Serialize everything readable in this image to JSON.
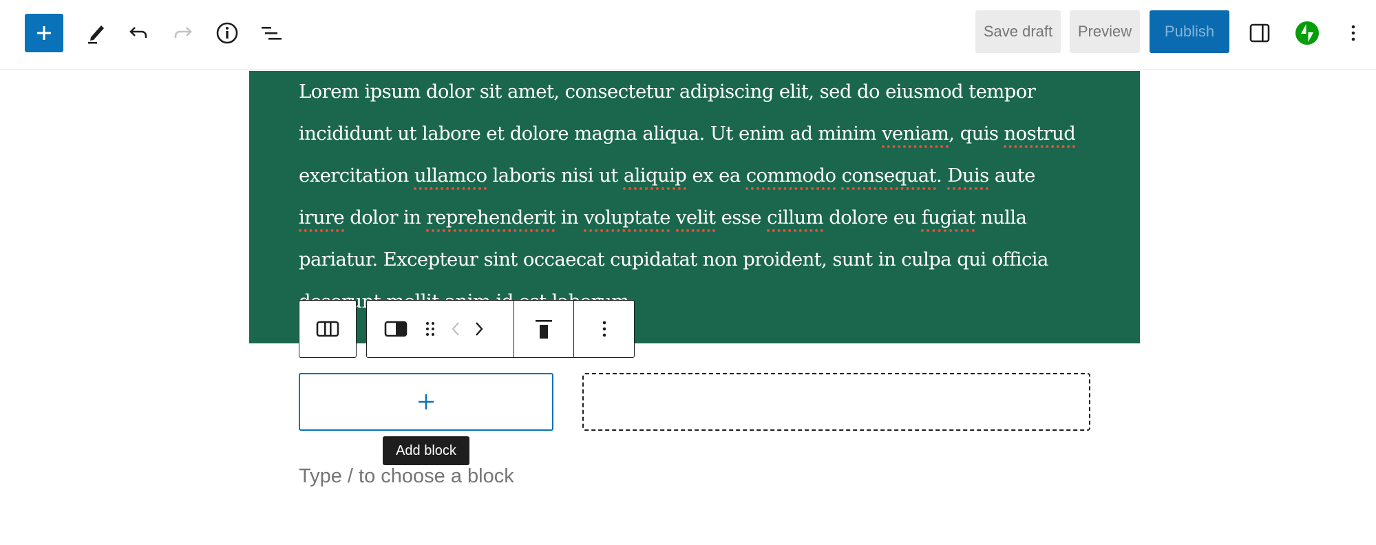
{
  "topbar": {
    "left_tools": [
      {
        "icon": "plus-icon",
        "label": "Toggle block inserter"
      },
      {
        "icon": "pencil-icon",
        "label": "Tools"
      },
      {
        "icon": "undo-icon",
        "label": "Undo"
      },
      {
        "icon": "redo-icon",
        "label": "Redo",
        "disabled": true
      },
      {
        "icon": "info-icon",
        "label": "Details"
      },
      {
        "icon": "list-view-icon",
        "label": "Document Overview"
      }
    ],
    "save_draft_label": "Save draft",
    "preview_label": "Preview",
    "publish_label": "Publish",
    "right_tools": [
      {
        "icon": "sidebar-toggle-icon",
        "label": "Settings"
      },
      {
        "icon": "jetpack-icon",
        "label": "Jetpack"
      },
      {
        "icon": "more-vertical-icon",
        "label": "Options"
      }
    ]
  },
  "colors": {
    "accent": "#0a72b9",
    "publish": "#0a6bb0",
    "cover_bg": "#1b674d",
    "spellcheck": "#e0503a",
    "jetpack": "#069e08"
  },
  "cover": {
    "lines": [
      [
        {
          "t": "Lorem ipsum dolor sit amet, consectetur adipiscing elit, sed do eiusmod tempor"
        }
      ],
      [
        {
          "t": "incididunt ut labore et dolore magna aliqua. Ut enim ad minim "
        },
        {
          "t": "veniam",
          "sp": true
        },
        {
          "t": ", quis "
        },
        {
          "t": "nostrud",
          "sp": true
        }
      ],
      [
        {
          "t": "exercitation "
        },
        {
          "t": "ullamco",
          "sp": true
        },
        {
          "t": " laboris nisi ut "
        },
        {
          "t": "aliquip",
          "sp": true
        },
        {
          "t": " ex ea "
        },
        {
          "t": "commodo",
          "sp": true
        },
        {
          "t": " "
        },
        {
          "t": "consequat",
          "sp": true
        },
        {
          "t": ". "
        },
        {
          "t": "Duis",
          "sp": true
        },
        {
          "t": " aute"
        }
      ],
      [
        {
          "t": "irure",
          "sp": true
        },
        {
          "t": " dolor in "
        },
        {
          "t": "reprehenderit",
          "sp": true
        },
        {
          "t": " in "
        },
        {
          "t": "voluptate",
          "sp": true
        },
        {
          "t": " "
        },
        {
          "t": "velit",
          "sp": true
        },
        {
          "t": " esse "
        },
        {
          "t": "cillum",
          "sp": true
        },
        {
          "t": " dolore eu "
        },
        {
          "t": "fugiat",
          "sp": true
        },
        {
          "t": " nulla"
        }
      ],
      [
        {
          "t": "pariatur. Excepteur sint occaecat cupidatat non proident, sunt in culpa qui officia"
        }
      ],
      [
        {
          "t": "deserunt mollit anim id est laborum."
        }
      ]
    ]
  },
  "block_toolbar": {
    "parent_label": "Select Columns",
    "items": [
      {
        "icon": "column-block-icon",
        "label": "Column"
      },
      {
        "icon": "drag-handle-icon",
        "label": "Drag"
      },
      {
        "icon": "chevron-left-icon",
        "label": "Move left",
        "disabled": true
      },
      {
        "icon": "chevron-right-icon",
        "label": "Move right"
      },
      {
        "icon": "align-top-icon",
        "label": "Change vertical alignment"
      },
      {
        "icon": "more-vertical-icon",
        "label": "Options"
      }
    ]
  },
  "columns": {
    "appender_icon": "plus-icon",
    "tooltip": "Add block"
  },
  "placeholder": "Type / to choose a block"
}
